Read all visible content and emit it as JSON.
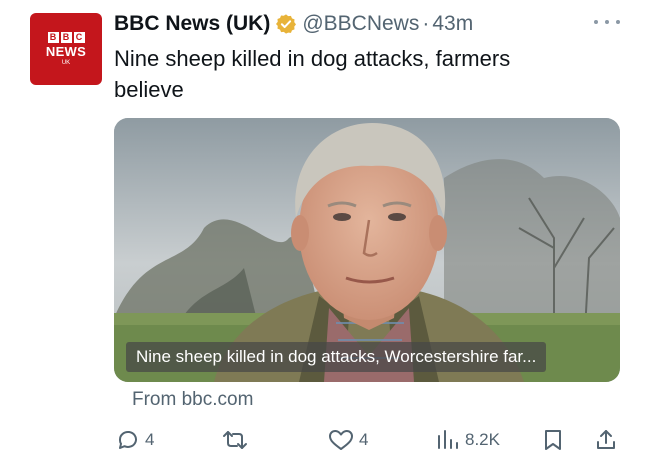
{
  "avatar": {
    "letters": [
      "B",
      "B",
      "C"
    ],
    "news": "NEWS",
    "region": "UK"
  },
  "tweet": {
    "display_name": "BBC News (UK)",
    "handle": "@BBCNews",
    "separator": "·",
    "time": "43m",
    "text": "Nine sheep killed in dog attacks, farmers believe"
  },
  "card": {
    "caption": "Nine sheep killed in dog attacks, Worcestershire far...",
    "source": "From bbc.com"
  },
  "actions": {
    "replies": "4",
    "likes": "4",
    "views": "8.2K"
  },
  "colors": {
    "verified_gold": "#e8b339",
    "bbc_red": "#c4161c",
    "muted_text": "#536471"
  }
}
